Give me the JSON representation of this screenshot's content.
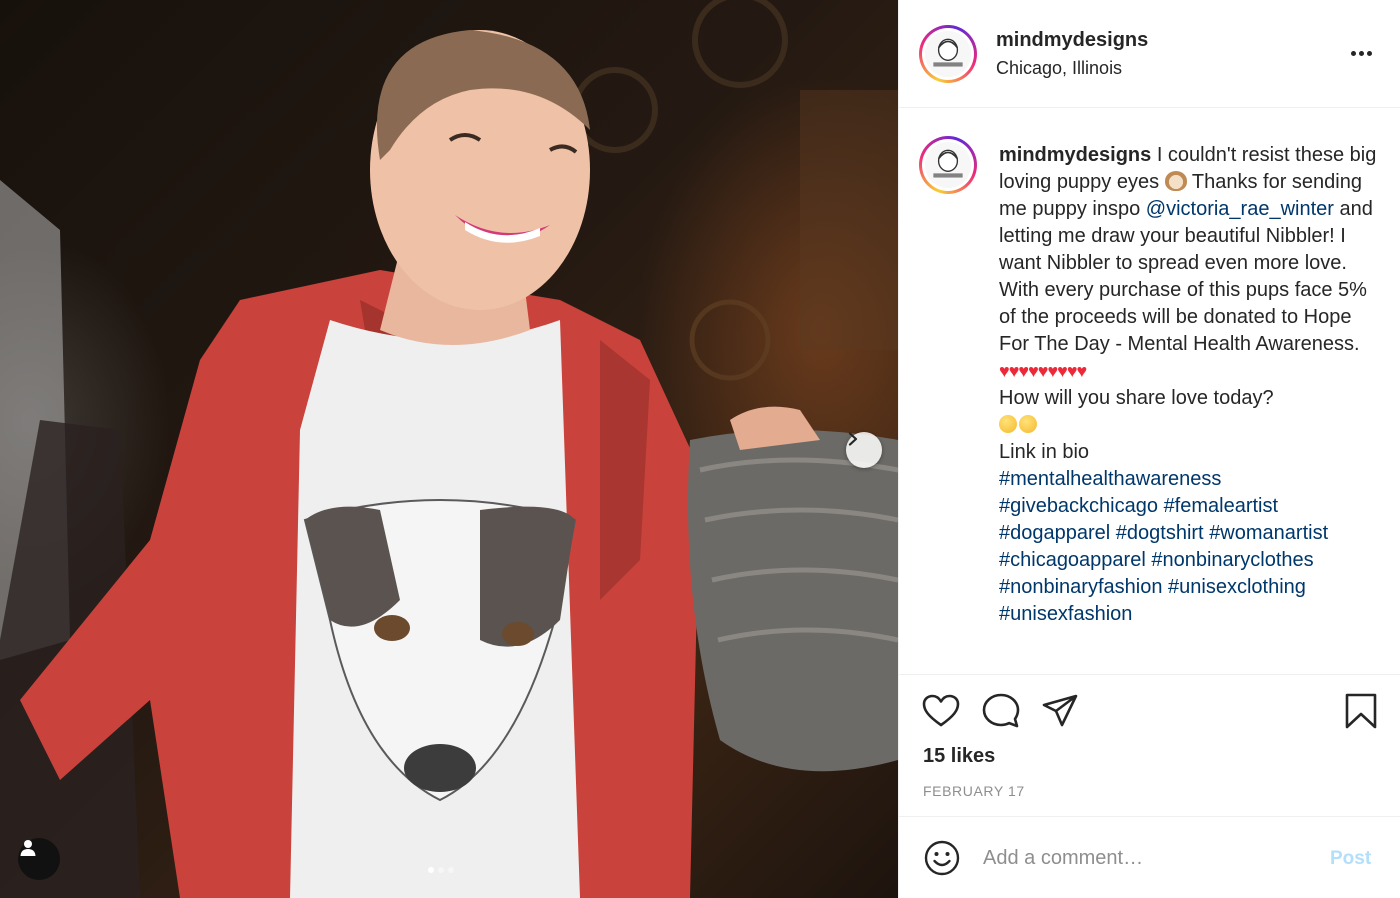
{
  "post": {
    "username": "mindmydesigns",
    "location": "Chicago, Illinois",
    "avatar_text": "MindMyDesigns"
  },
  "caption": {
    "username": "mindmydesigns",
    "text_1": " I couldn't resist these big loving puppy eyes ",
    "text_2": " Thanks for sending me puppy inspo ",
    "mention": "@victoria_rae_winter",
    "text_3": " and letting me draw your beautiful Nibbler! I want Nibbler to spread even more love. With every purchase of this pups face 5% of the proceeds will be donated to Hope For The Day - Mental Health Awareness.",
    "hearts": "♥♥♥♥♥♥♥♥♥",
    "question": "How will you share love today?",
    "link": "Link in bio",
    "hashtags": [
      "#mentalhealthawareness",
      "#givebackchicago",
      "#femaleartist",
      "#dogapparel",
      "#dogtshirt",
      "#womanartist",
      "#chicagoapparel",
      "#nonbinaryclothes",
      "#nonbinaryfashion",
      "#unisexclothing",
      "#unisexfashion"
    ]
  },
  "actions": {
    "likes": "15 likes",
    "date": "FEBRUARY 17"
  },
  "comment": {
    "placeholder": "Add a comment…",
    "post_label": "Post"
  },
  "carousel": {
    "slide_count": 3,
    "active_index": 0
  },
  "colors": {
    "link": "#00376b",
    "post_disabled": "#b2dffc",
    "muted": "#8e8e8e",
    "text": "#262626"
  },
  "icons": [
    "ellipsis-icon",
    "chevron-right-icon",
    "user-tag-icon",
    "heart-icon",
    "comment-icon",
    "share-icon",
    "bookmark-icon",
    "smiley-icon"
  ]
}
